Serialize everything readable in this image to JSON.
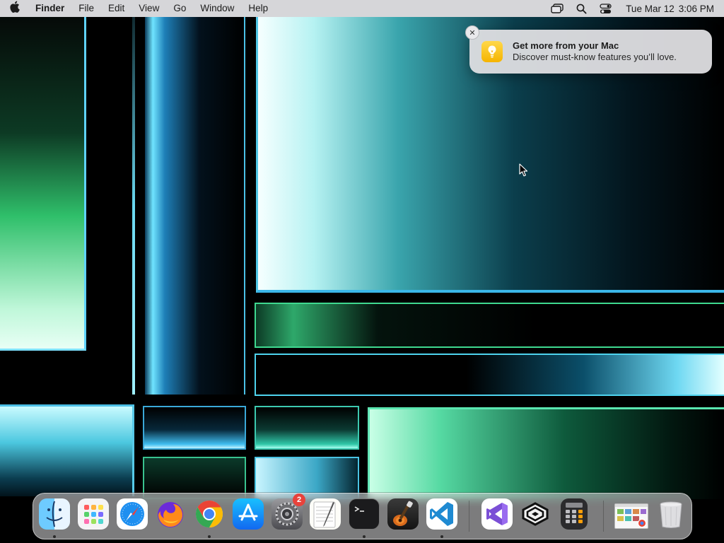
{
  "menubar": {
    "apple_icon": "apple-logo-icon",
    "app_name": "Finder",
    "menus": [
      "File",
      "Edit",
      "View",
      "Go",
      "Window",
      "Help"
    ],
    "status_icons": [
      "screen-mirroring-icon",
      "spotlight-search-icon",
      "control-center-icon"
    ],
    "clock": {
      "date": "Tue Mar 12",
      "time": "3:06 PM"
    }
  },
  "notification": {
    "icon": "lightbulb-icon",
    "title": "Get more from your Mac",
    "body": "Discover must-know features you’ll love.",
    "close_icon": "close-icon"
  },
  "dock": {
    "apps": [
      {
        "name": "Finder",
        "icon": "finder-icon",
        "running": true
      },
      {
        "name": "Launchpad",
        "icon": "launchpad-icon",
        "running": false
      },
      {
        "name": "Safari",
        "icon": "safari-icon",
        "running": false
      },
      {
        "name": "Firefox",
        "icon": "firefox-icon",
        "running": false
      },
      {
        "name": "Google Chrome",
        "icon": "chrome-icon",
        "running": true
      },
      {
        "name": "App Store",
        "icon": "app-store-icon",
        "running": false
      },
      {
        "name": "System Settings",
        "icon": "system-settings-icon",
        "running": false,
        "badge": "2"
      },
      {
        "name": "TextEdit",
        "icon": "textedit-icon",
        "running": false
      },
      {
        "name": "Terminal",
        "icon": "terminal-icon",
        "running": true
      },
      {
        "name": "GarageBand",
        "icon": "garageband-icon",
        "running": false
      },
      {
        "name": "Visual Studio Code",
        "icon": "vscode-icon",
        "running": true
      },
      {
        "name": "Visual Studio",
        "icon": "visual-studio-icon",
        "running": false
      },
      {
        "name": "Unknown App",
        "icon": "hexagon-app-icon",
        "running": false
      },
      {
        "name": "Calculator",
        "icon": "calculator-icon",
        "running": false
      },
      {
        "name": "Recent Window",
        "icon": "chrome-window-thumbnail-icon",
        "running": false
      },
      {
        "name": "Trash",
        "icon": "trash-icon",
        "running": false
      }
    ]
  },
  "colors": {
    "menubar_bg": "#e8e8ec",
    "notification_bg": "#dedee2",
    "badge": "#e8423b",
    "wallpaper_accent_cyan": "#4fc6e6",
    "wallpaper_accent_green": "#3fd990"
  }
}
